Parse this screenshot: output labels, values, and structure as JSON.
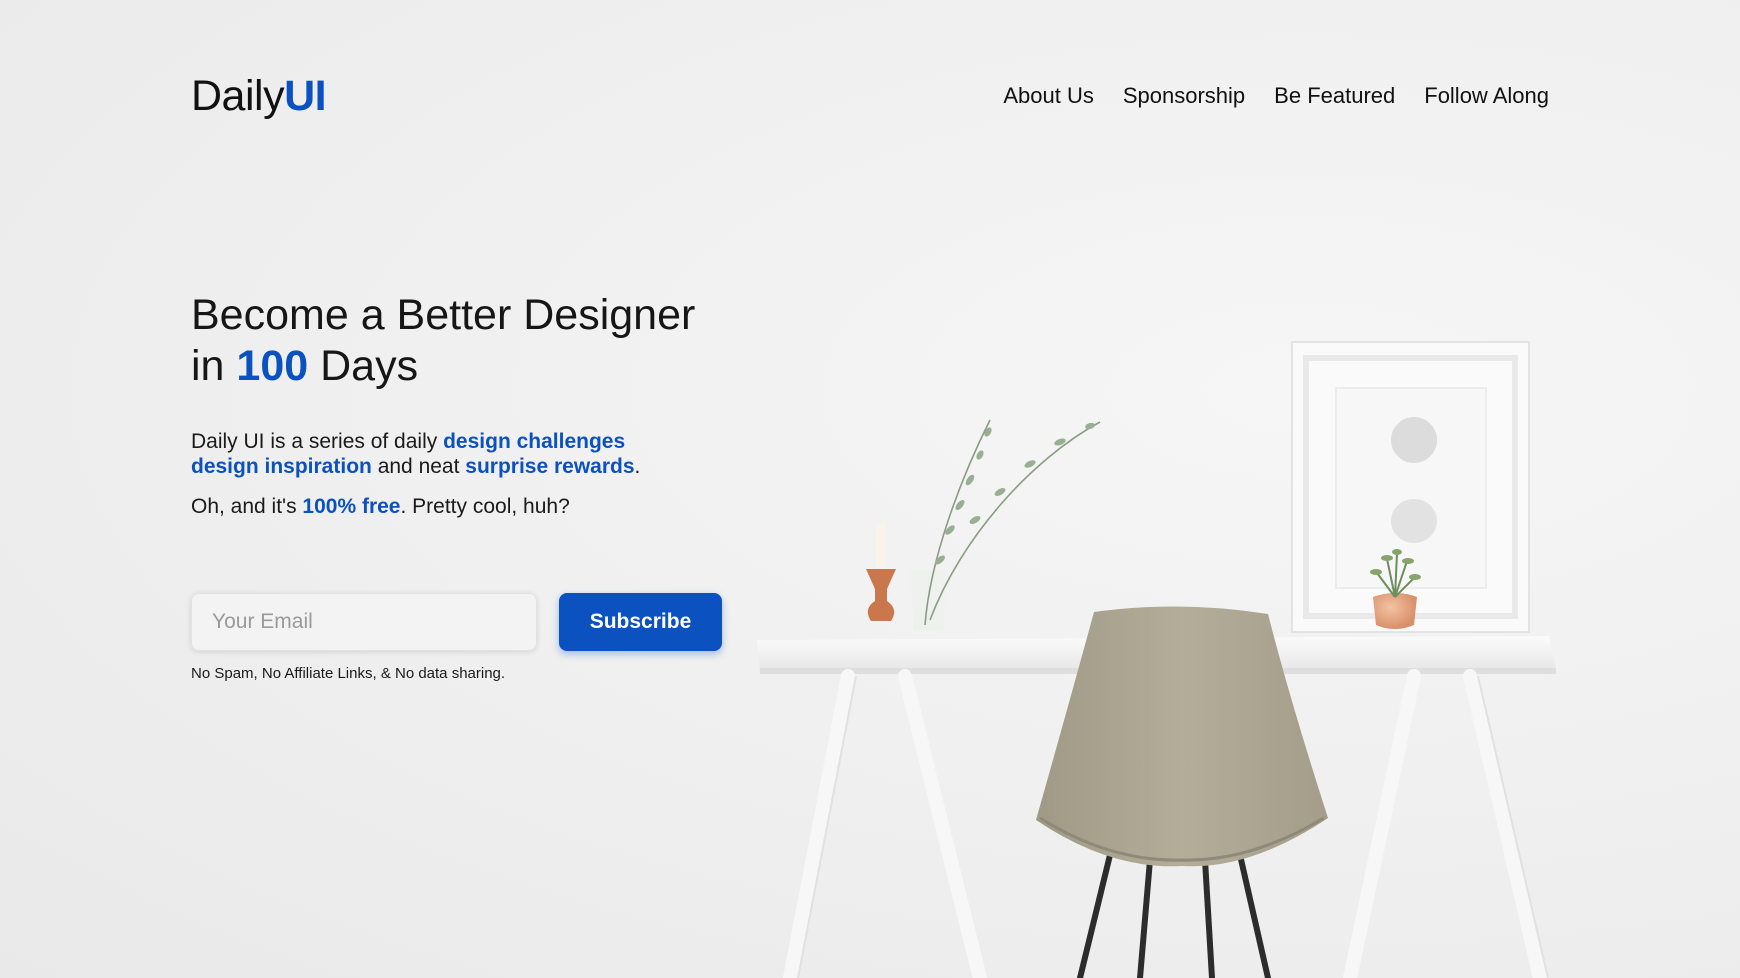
{
  "brand": {
    "prefix": "Daily",
    "accent": "UI"
  },
  "nav": {
    "items": [
      {
        "label": "About Us"
      },
      {
        "label": "Sponsorship"
      },
      {
        "label": "Be Featured"
      },
      {
        "label": "Follow Along"
      }
    ]
  },
  "hero": {
    "title_line1": "Become a Better Designer",
    "title_line2_prefix": "in ",
    "title_line2_number": "100",
    "title_line2_suffix": " Days",
    "intro_prefix": "Daily UI is a series of daily ",
    "intro_hl1": "design challenges",
    "intro_hl2": "design inspiration",
    "intro_mid": " and neat ",
    "intro_hl3": "surprise rewards",
    "intro_end": ".",
    "free_prefix": "Oh, and it's ",
    "free_hl": "100% free",
    "free_suffix": ". Pretty cool, huh?"
  },
  "form": {
    "email_placeholder": "Your Email",
    "email_value": "",
    "subscribe_label": "Subscribe",
    "disclaimer": "No Spam, No Affiliate Links, & No data sharing."
  },
  "colors": {
    "accent": "#0b52c0",
    "background": "#f0f0f0",
    "text": "#1a1a1a",
    "chair": "#aea894"
  },
  "icons": {
    "scene": "desk-chair-photo"
  }
}
